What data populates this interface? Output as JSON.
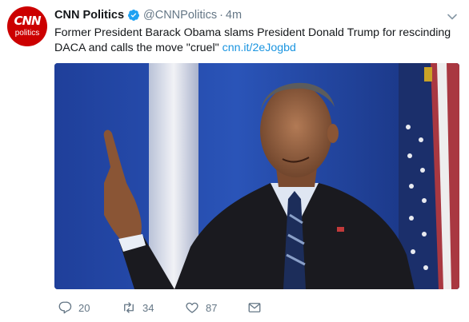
{
  "tweet": {
    "account_name": "CNN Politics",
    "handle": "@CNNPolitics",
    "separator": "·",
    "time": "4m",
    "avatar_logo_top": "CNN",
    "avatar_logo_bottom": "politics",
    "text": "Former President Barack Obama slams President Donald Trump for rescinding DACA and calls the move \"cruel\"",
    "link": "cnn.it/2eJogbd",
    "verified": true
  },
  "actions": {
    "reply_count": "20",
    "retweet_count": "34",
    "like_count": "87"
  },
  "icons": {
    "verified": "verified-badge-icon",
    "reply": "reply-icon",
    "retweet": "retweet-icon",
    "like": "heart-icon",
    "message": "envelope-icon",
    "menu": "chevron-down-icon"
  },
  "colors": {
    "brand": "#cc0000",
    "link": "#1b95e0",
    "verified": "#1da1f2",
    "secondary_text": "#657786"
  }
}
